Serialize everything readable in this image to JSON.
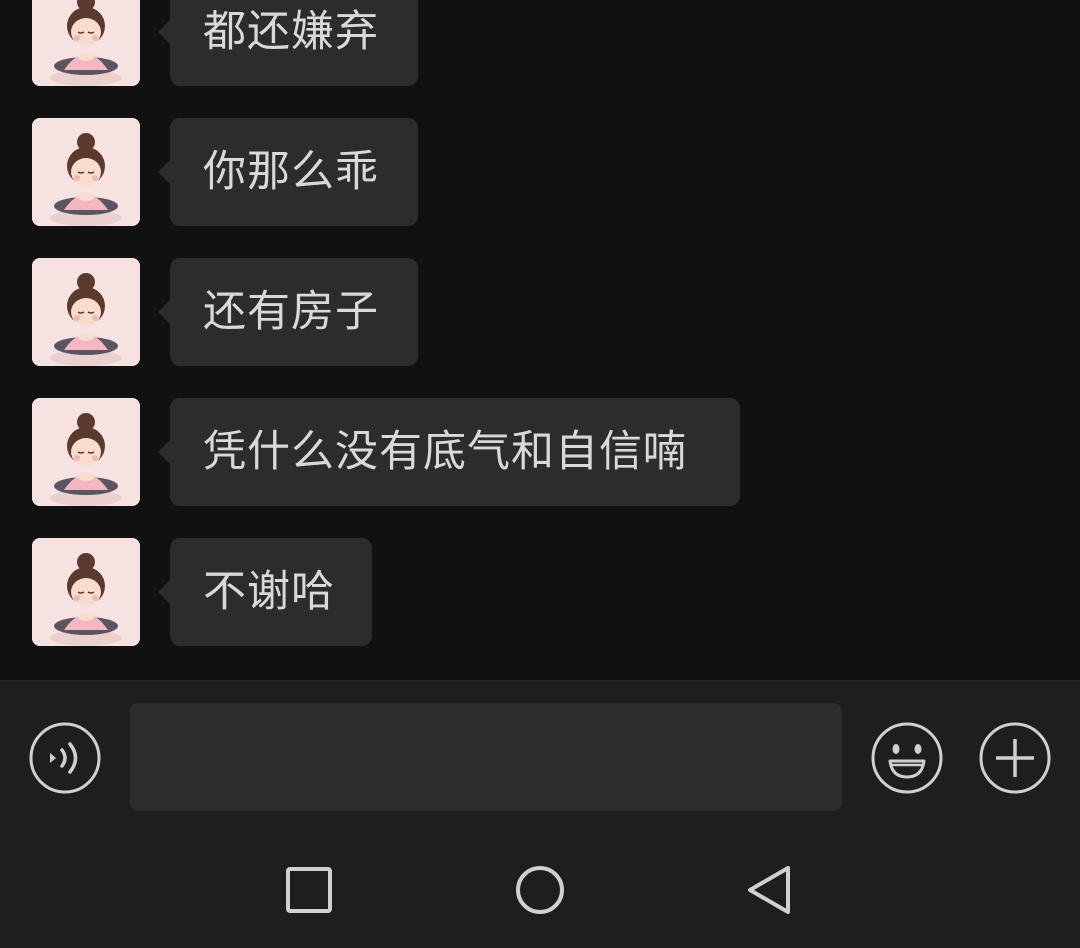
{
  "messages": [
    {
      "text": "都还嫌弃"
    },
    {
      "text": "你那么乖"
    },
    {
      "text": "还有房子"
    },
    {
      "text": "凭什么没有底气和自信喃"
    },
    {
      "text": "不谢哈"
    }
  ],
  "input": {
    "value": "",
    "placeholder": ""
  },
  "icons": {
    "voice": "voice-input-icon",
    "emoji": "emoji-icon",
    "plus": "plus-icon",
    "recent": "recent-apps-icon",
    "home": "home-icon",
    "back": "back-icon"
  },
  "colors": {
    "background": "#111111",
    "bubble": "#2c2c2c",
    "text": "#d9d9d9",
    "bar": "#1e1e1e",
    "icon": "#d0d0d0"
  }
}
